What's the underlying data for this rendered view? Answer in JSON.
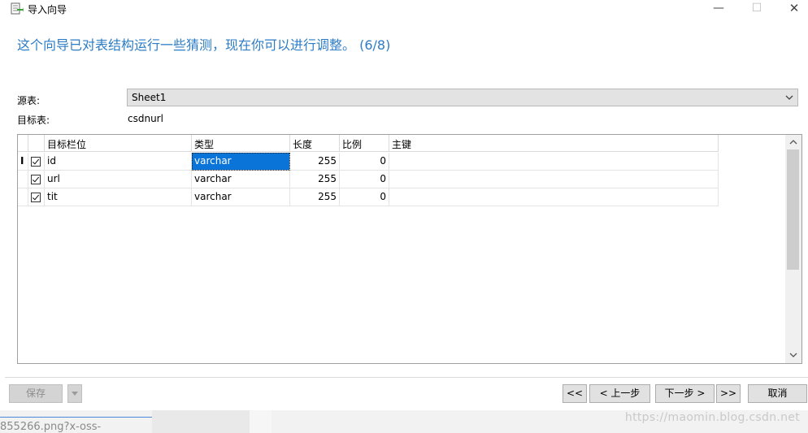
{
  "window": {
    "title": "导入向导",
    "minimize_glyph": "—",
    "maximize_glyph": "☐",
    "close_glyph": "✕"
  },
  "heading": "这个向导已对表结构运行一些猜测，现在你可以进行调整。 (6/8)",
  "source": {
    "label": "源表:",
    "value": "Sheet1"
  },
  "target": {
    "label": "目标表:",
    "value": "csdnurl"
  },
  "grid": {
    "columns": [
      "目标栏位",
      "类型",
      "长度",
      "比例",
      "主键"
    ],
    "rows": [
      {
        "checked": true,
        "field": "id",
        "type": "varchar",
        "length": "255",
        "scale": "0",
        "key": ""
      },
      {
        "checked": true,
        "field": "url",
        "type": "varchar",
        "length": "255",
        "scale": "0",
        "key": ""
      },
      {
        "checked": true,
        "field": "tit",
        "type": "varchar",
        "length": "255",
        "scale": "0",
        "key": ""
      }
    ],
    "row_cursor": "I"
  },
  "buttons": {
    "save": "保存",
    "first": "<<",
    "prev": "< 上一步",
    "next": "下一步 >",
    "last": ">>",
    "cancel": "取消"
  },
  "background": {
    "fragment_text": "855266.png?x-oss-",
    "watermark": "https://maomin.blog.csdn.net"
  },
  "colors": {
    "heading": "#2d7cc4",
    "selection": "#0a74d8"
  },
  "icons": {
    "app": "import-wizard-icon",
    "select_arrow": "chevron-down-icon",
    "scroll_up": "chevron-up-icon",
    "scroll_down": "chevron-down-icon"
  }
}
